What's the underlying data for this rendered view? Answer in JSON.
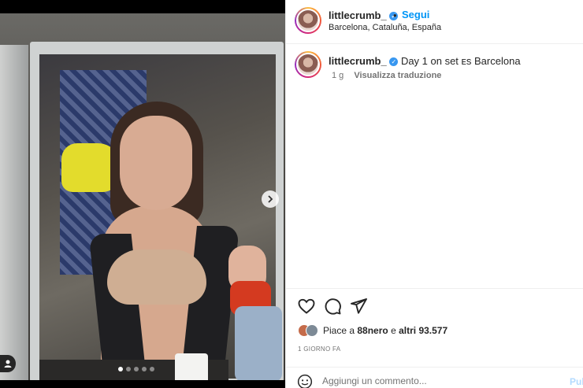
{
  "media": {
    "slide_count": 5,
    "active_slide": 1,
    "next_icon": "chevron-right-icon",
    "tag_icon": "user-tag-icon"
  },
  "header": {
    "username": "littlecrumb_",
    "verified_icon": "verified-badge-icon",
    "separator": "•",
    "follow_label": "Segui",
    "location": "Barcelona, Cataluña, España"
  },
  "caption": {
    "username": "littlecrumb_",
    "text": "Day 1 on set ᴇs Barcelona",
    "time": "1 g",
    "translate_label": "Visualizza traduzione"
  },
  "actions": {
    "like_icon": "heart-icon",
    "comment_icon": "comment-icon",
    "share_icon": "send-icon",
    "likes_prefix": "Piace a",
    "likes_user": "88nero",
    "likes_middle": "e",
    "likes_others": "altri 93.577",
    "time_ago": "1 GIORNO FA"
  },
  "comment": {
    "emoji_icon": "emoji-icon",
    "placeholder": "Aggiungi un commento...",
    "post_label": "Pul"
  },
  "colors": {
    "accent": "#0095f6",
    "verified": "#3897f0",
    "text": "#262626",
    "muted": "#737373"
  }
}
